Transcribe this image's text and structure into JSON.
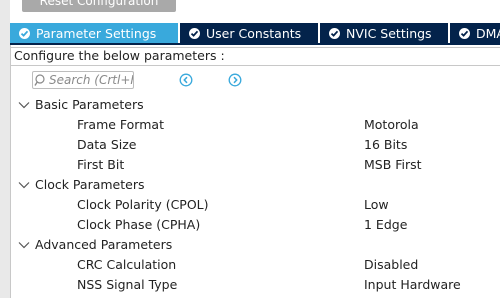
{
  "toolbar": {
    "reset_label": "Reset Configuration"
  },
  "tabs": [
    {
      "label": "Parameter Settings",
      "active": true
    },
    {
      "label": "User Constants",
      "active": false
    },
    {
      "label": "NVIC Settings",
      "active": false
    },
    {
      "label": "DMA",
      "active": false
    }
  ],
  "configure_text": "Configure the below parameters :",
  "search": {
    "placeholder": "Search (Crtl+F)"
  },
  "groups": [
    {
      "label": "Basic Parameters",
      "params": [
        {
          "name": "Frame Format",
          "value": "Motorola"
        },
        {
          "name": "Data Size",
          "value": "16 Bits"
        },
        {
          "name": "First Bit",
          "value": "MSB First"
        }
      ]
    },
    {
      "label": "Clock Parameters",
      "params": [
        {
          "name": "Clock Polarity (CPOL)",
          "value": "Low"
        },
        {
          "name": "Clock Phase (CPHA)",
          "value": "1 Edge"
        }
      ]
    },
    {
      "label": "Advanced Parameters",
      "params": [
        {
          "name": "CRC Calculation",
          "value": "Disabled"
        },
        {
          "name": "NSS Signal Type",
          "value": "Input Hardware"
        }
      ]
    }
  ],
  "colors": {
    "tab_active": "#39a9dc",
    "tab_inactive": "#03234b",
    "nav_icon": "#39a9dc"
  }
}
